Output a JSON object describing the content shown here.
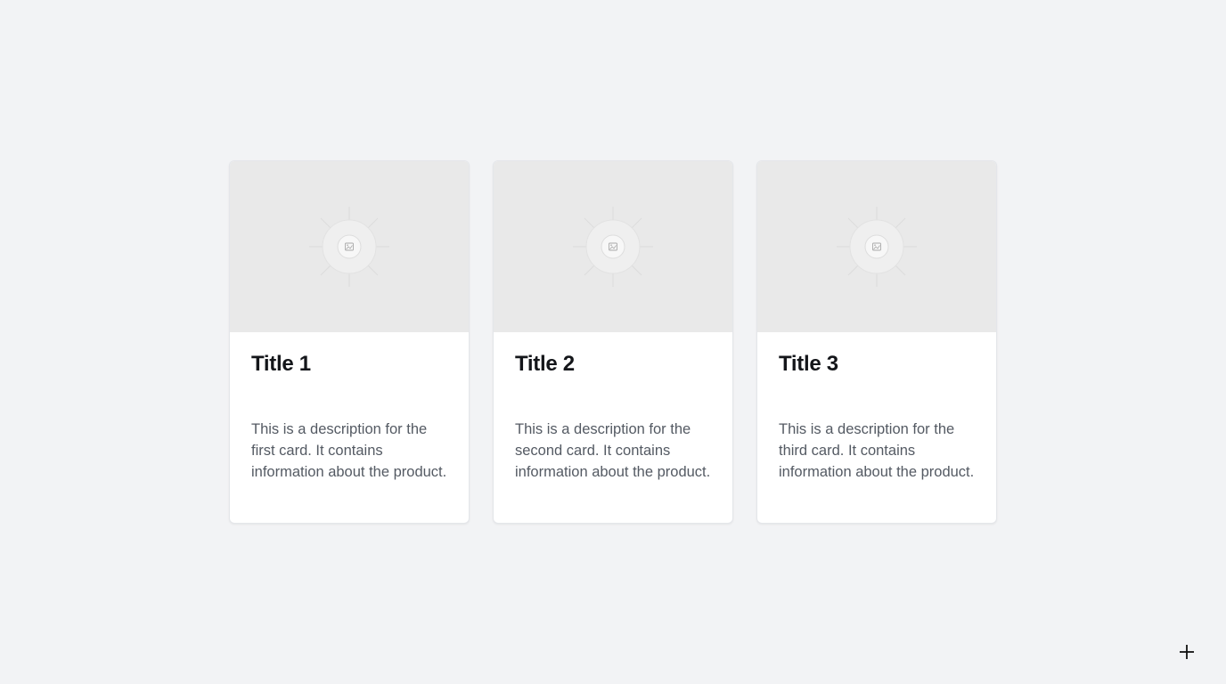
{
  "cards": [
    {
      "title": "Title 1",
      "description": "This is a description for the first card. It contains information about the product.",
      "image_icon": "image-placeholder-icon"
    },
    {
      "title": "Title 2",
      "description": "This is a description for the second card. It contains information about the product.",
      "image_icon": "image-placeholder-icon"
    },
    {
      "title": "Title 3",
      "description": "This is a description for the third card. It contains information about the product.",
      "image_icon": "image-placeholder-icon"
    }
  ],
  "corner_action": {
    "icon": "plus-icon"
  },
  "colors": {
    "background": "#f2f3f5",
    "card": "#ffffff",
    "image_placeholder": "#e9e9e9",
    "title": "#14161a",
    "description": "#545a63"
  }
}
